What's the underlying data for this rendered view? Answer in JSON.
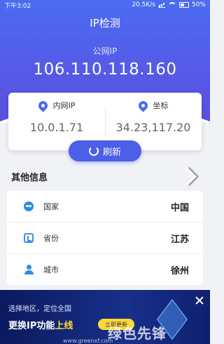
{
  "status_bar": {
    "time": "下午3:02",
    "speed": "20.5K/s",
    "battery": "50%"
  },
  "title": "IP检测",
  "public_ip": {
    "label": "公网IP",
    "value": "106.110.118.160"
  },
  "card": {
    "inner_ip": {
      "label": "内网IP",
      "value": "10.0.1.71"
    },
    "coords": {
      "label": "坐标",
      "value": "34.23,117.20"
    }
  },
  "refresh_label": "刷新",
  "section_title": "其他信息",
  "rows": [
    {
      "label": "国家",
      "value": "中国",
      "icon": "globe-icon"
    },
    {
      "label": "省份",
      "value": "江苏",
      "icon": "region-icon"
    },
    {
      "label": "城市",
      "value": "徐州",
      "icon": "city-icon"
    }
  ],
  "ad": {
    "line1": "选择地区，定位全国",
    "line2_main": "更换IP功能",
    "line2_highlight": "上线",
    "button": "立即更新",
    "watermark": "绿色先锋",
    "watermark_url": "www.greenxf.com"
  },
  "colors": {
    "accent": "#4b5fe8",
    "header_top": "#4b6cf0",
    "header_bottom": "#5c4de0",
    "ad_bg": "#0b1a5e",
    "ad_highlight": "#ffd83a"
  }
}
